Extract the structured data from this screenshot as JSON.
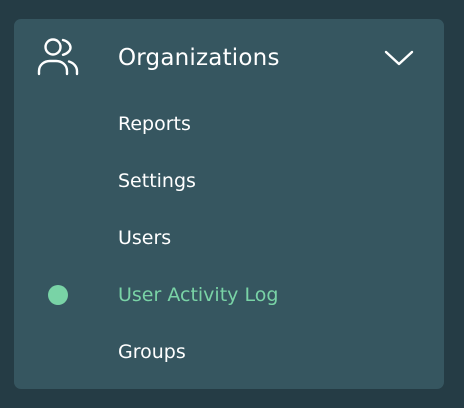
{
  "colors": {
    "background": "#253c45",
    "panel": "#365660",
    "text": "#ffffff",
    "accent": "#79d3a6"
  },
  "nav": {
    "header": {
      "label": "Organizations",
      "icon": "users-icon",
      "toggle_icon": "chevron-down-icon",
      "expanded": true
    },
    "items": [
      {
        "label": "Reports",
        "active": false
      },
      {
        "label": "Settings",
        "active": false
      },
      {
        "label": "Users",
        "active": false
      },
      {
        "label": "User Activity Log",
        "active": true
      },
      {
        "label": "Groups",
        "active": false
      }
    ]
  }
}
